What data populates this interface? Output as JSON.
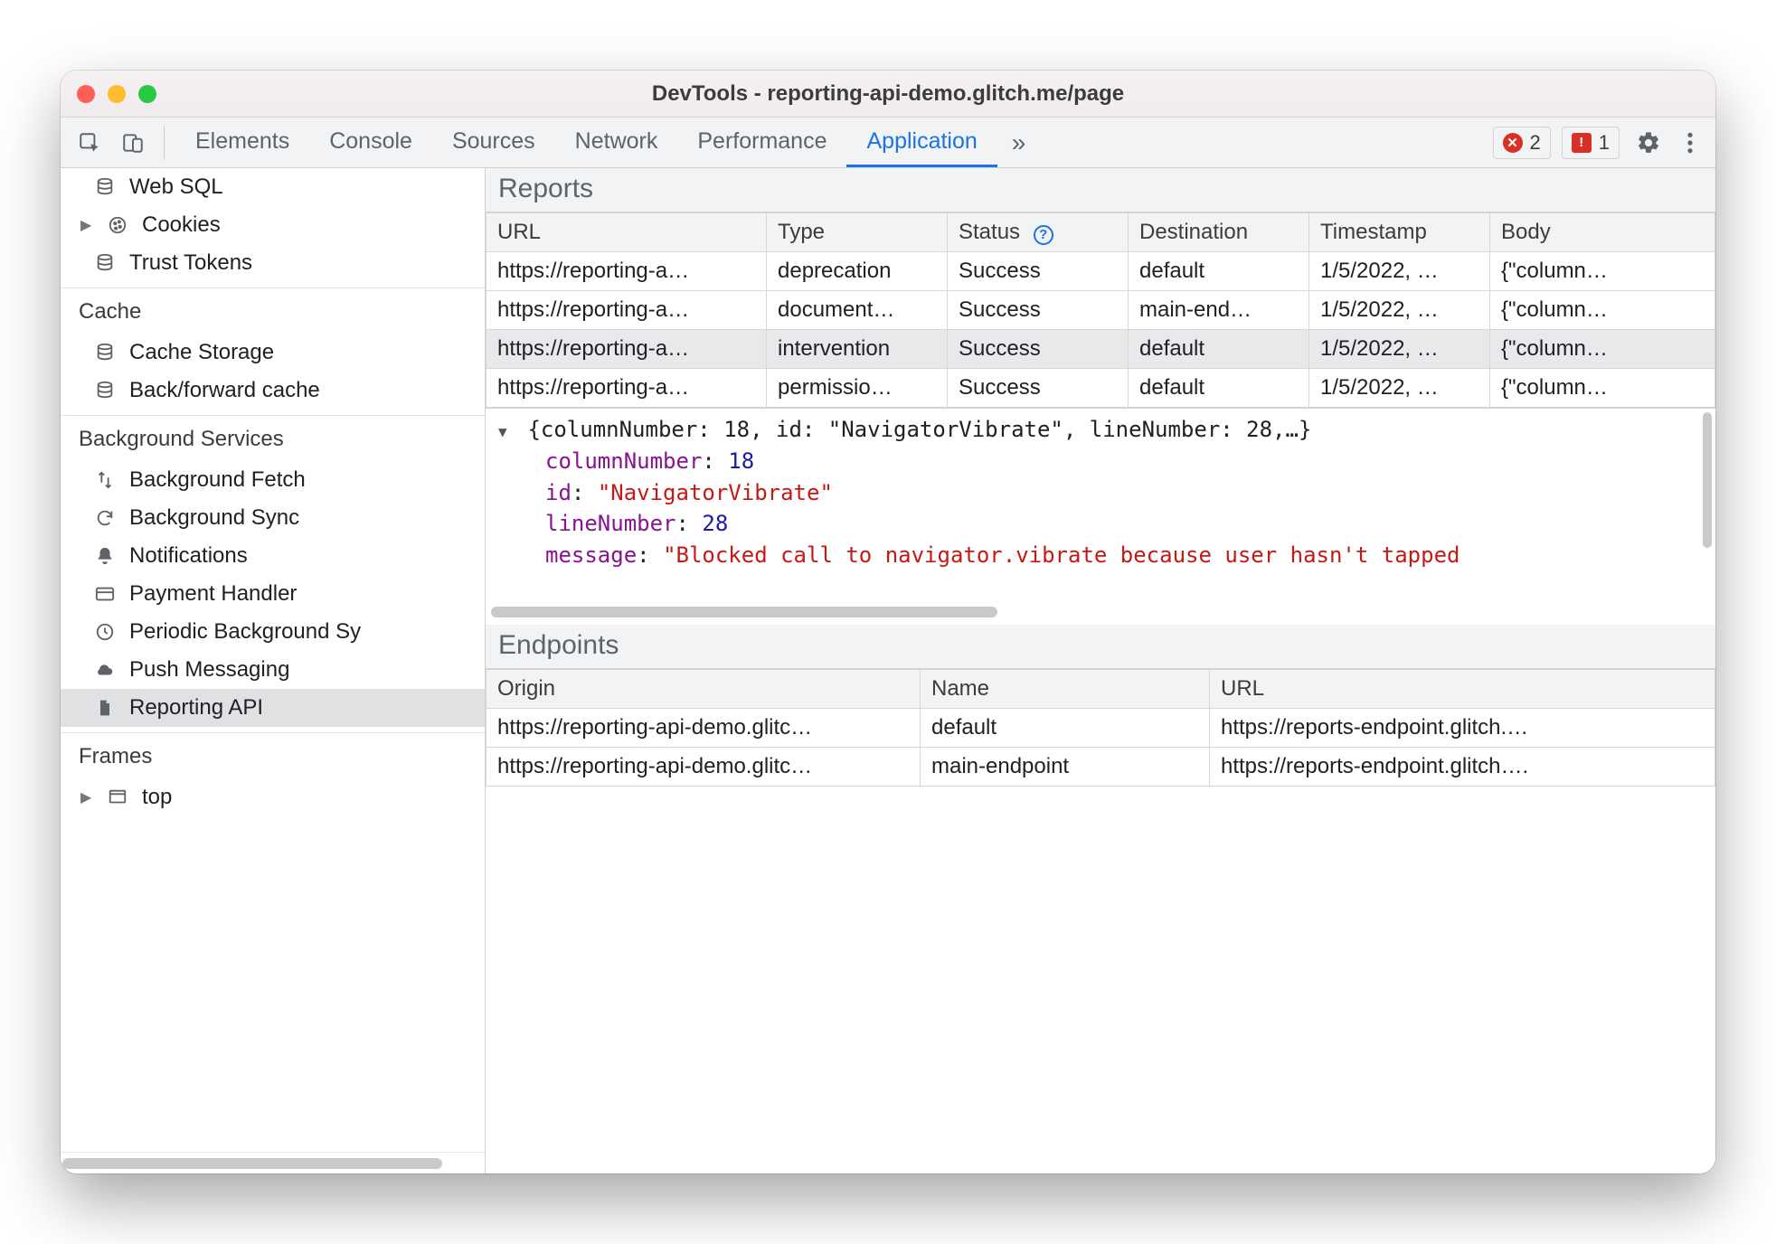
{
  "window": {
    "title": "DevTools - reporting-api-demo.glitch.me/page"
  },
  "topbar": {
    "tabs": [
      "Elements",
      "Console",
      "Sources",
      "Network",
      "Performance",
      "Application"
    ],
    "active_tab_index": 5,
    "error_count": "2",
    "issue_count": "1"
  },
  "sidebar": {
    "group_storage": {
      "items": [
        {
          "label": "Web SQL",
          "icon": "database"
        },
        {
          "label": "Cookies",
          "icon": "cookie",
          "expandable": true
        },
        {
          "label": "Trust Tokens",
          "icon": "database"
        }
      ]
    },
    "group_cache": {
      "title": "Cache",
      "items": [
        {
          "label": "Cache Storage",
          "icon": "database"
        },
        {
          "label": "Back/forward cache",
          "icon": "database"
        }
      ]
    },
    "group_bg": {
      "title": "Background Services",
      "items": [
        {
          "label": "Background Fetch",
          "icon": "updown"
        },
        {
          "label": "Background Sync",
          "icon": "sync"
        },
        {
          "label": "Notifications",
          "icon": "bell"
        },
        {
          "label": "Payment Handler",
          "icon": "card"
        },
        {
          "label": "Periodic Background Sy",
          "icon": "clock"
        },
        {
          "label": "Push Messaging",
          "icon": "cloud"
        },
        {
          "label": "Reporting API",
          "icon": "file",
          "selected": true
        }
      ]
    },
    "group_frames": {
      "title": "Frames",
      "items": [
        {
          "label": "top",
          "icon": "frame",
          "expandable": true
        }
      ]
    }
  },
  "reports": {
    "title": "Reports",
    "headers": [
      "URL",
      "Type",
      "Status",
      "Destination",
      "Timestamp",
      "Body"
    ],
    "rows": [
      {
        "url": "https://reporting-a…",
        "type": "deprecation",
        "status": "Success",
        "destination": "default",
        "timestamp": "1/5/2022, …",
        "body": "{\"column…"
      },
      {
        "url": "https://reporting-a…",
        "type": "document…",
        "status": "Success",
        "destination": "main-end…",
        "timestamp": "1/5/2022, …",
        "body": "{\"column…"
      },
      {
        "url": "https://reporting-a…",
        "type": "intervention",
        "status": "Success",
        "destination": "default",
        "timestamp": "1/5/2022, …",
        "body": "{\"column…",
        "selected": true
      },
      {
        "url": "https://reporting-a…",
        "type": "permissio…",
        "status": "Success",
        "destination": "default",
        "timestamp": "1/5/2022, …",
        "body": "{\"column…"
      }
    ]
  },
  "preview": {
    "summary": "{columnNumber: 18, id: \"NavigatorVibrate\", lineNumber: 28,…}",
    "columnNumber_key": "columnNumber",
    "columnNumber_val": "18",
    "id_key": "id",
    "id_val": "\"NavigatorVibrate\"",
    "lineNumber_key": "lineNumber",
    "lineNumber_val": "28",
    "message_key": "message",
    "message_val": "\"Blocked call to navigator.vibrate because user hasn't tapped"
  },
  "endpoints": {
    "title": "Endpoints",
    "headers": [
      "Origin",
      "Name",
      "URL"
    ],
    "rows": [
      {
        "origin": "https://reporting-api-demo.glitc…",
        "name": "default",
        "url": "https://reports-endpoint.glitch.…"
      },
      {
        "origin": "https://reporting-api-demo.glitc…",
        "name": "main-endpoint",
        "url": "https://reports-endpoint.glitch…."
      }
    ]
  }
}
